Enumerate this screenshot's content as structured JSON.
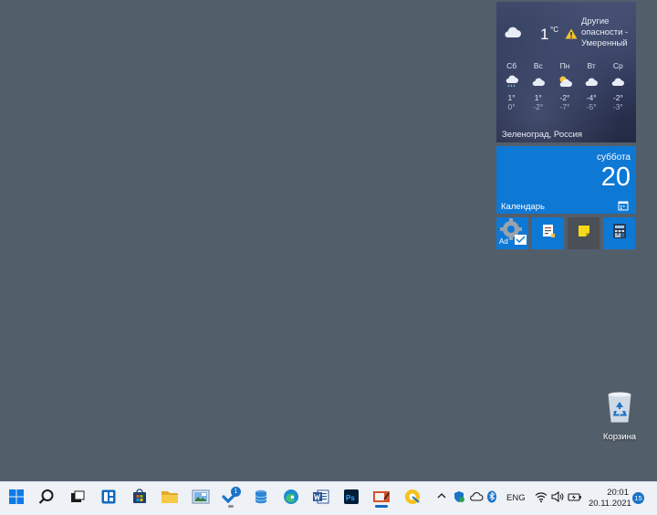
{
  "weather": {
    "temperature": "1",
    "unit": "°C",
    "alert": "Другие опасности - Умеренный",
    "location": "Зеленоград, Россия",
    "forecast": [
      {
        "day": "Сб",
        "high": "1°",
        "low": "0°",
        "icon": "rain-cloud-icon"
      },
      {
        "day": "Вс",
        "high": "1°",
        "low": "-2°",
        "icon": "cloud-icon"
      },
      {
        "day": "Пн",
        "high": "-2°",
        "low": "-7°",
        "icon": "partly-sunny-icon"
      },
      {
        "day": "Вт",
        "high": "-4°",
        "low": "-5°",
        "icon": "cloud-icon"
      },
      {
        "day": "Ср",
        "high": "-2°",
        "low": "-3°",
        "icon": "cloud-icon"
      }
    ]
  },
  "calendar": {
    "weekday": "суббота",
    "day": "20",
    "app_name": "Календарь"
  },
  "small_tiles": [
    {
      "name": "settings-tile",
      "label": "Ad",
      "icon": "gear-icon"
    },
    {
      "name": "sticky-notes-blue-tile",
      "icon": "notes-icon"
    },
    {
      "name": "sticky-notes-tile",
      "icon": "sticky-note-icon"
    },
    {
      "name": "calculator-tile",
      "icon": "calculator-icon"
    }
  ],
  "desktop": {
    "recycle_bin_label": "Корзина"
  },
  "taskbar": {
    "badge_count": "1",
    "language": "ENG",
    "time": "20:01",
    "date": "20.11.2021",
    "notification_count": "15"
  },
  "colors": {
    "desktop": "#535e6b",
    "tile_blue": "#0e78d5",
    "taskbar": "#eef1f6"
  }
}
